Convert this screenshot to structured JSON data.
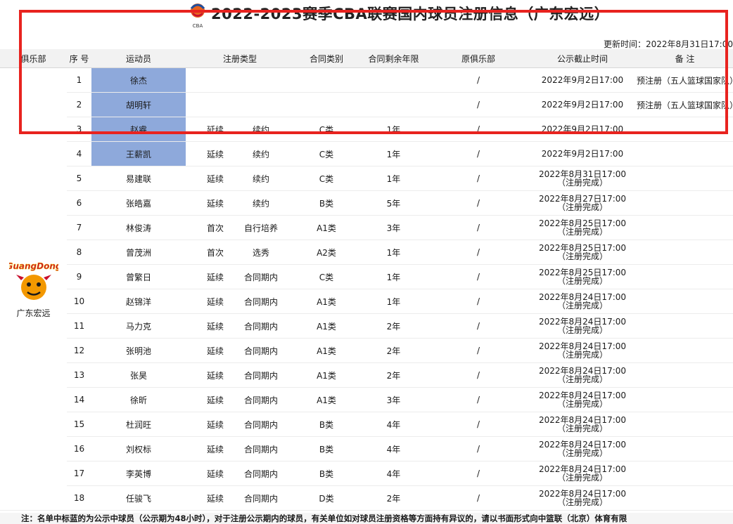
{
  "header": {
    "logo_text": "CBA",
    "title": "2022-2023赛季CBA联赛国内球员注册信息（广东宏远）",
    "updated": "更新时间：2022年8月31日17:00"
  },
  "columns": [
    "俱乐部",
    "序 号",
    "运动员",
    "注册类型",
    "合同类别",
    "合同剩余年限",
    "原俱乐部",
    "公示截止时间",
    "备 注"
  ],
  "club": {
    "name": "广东宏远",
    "logo_text": "GuangDong"
  },
  "rows": [
    {
      "no": "1",
      "name": "徐杰",
      "reg_type": "",
      "reg_sub": "",
      "contract": "",
      "years": "",
      "prev": "/",
      "cutoff1": "2022年9月2日17:00",
      "cutoff2": "",
      "note": "预注册（五人篮球国家队）",
      "hl": true
    },
    {
      "no": "2",
      "name": "胡明轩",
      "reg_type": "",
      "reg_sub": "",
      "contract": "",
      "years": "",
      "prev": "/",
      "cutoff1": "2022年9月2日17:00",
      "cutoff2": "",
      "note": "预注册（五人篮球国家队）",
      "hl": true
    },
    {
      "no": "3",
      "name": "赵睿",
      "reg_type": "延续",
      "reg_sub": "续约",
      "contract": "C类",
      "years": "1年",
      "prev": "/",
      "cutoff1": "2022年9月2日17:00",
      "cutoff2": "",
      "note": "",
      "hl": true
    },
    {
      "no": "4",
      "name": "王薪凯",
      "reg_type": "延续",
      "reg_sub": "续约",
      "contract": "C类",
      "years": "1年",
      "prev": "/",
      "cutoff1": "2022年9月2日17:00",
      "cutoff2": "",
      "note": "",
      "hl": true
    },
    {
      "no": "5",
      "name": "易建联",
      "reg_type": "延续",
      "reg_sub": "续约",
      "contract": "C类",
      "years": "1年",
      "prev": "/",
      "cutoff1": "2022年8月31日17:00",
      "cutoff2": "（注册完成）",
      "note": "",
      "hl": false
    },
    {
      "no": "6",
      "name": "张皓嘉",
      "reg_type": "延续",
      "reg_sub": "续约",
      "contract": "B类",
      "years": "5年",
      "prev": "/",
      "cutoff1": "2022年8月27日17:00",
      "cutoff2": "（注册完成）",
      "note": "",
      "hl": false
    },
    {
      "no": "7",
      "name": "林俊涛",
      "reg_type": "首次",
      "reg_sub": "自行培养",
      "contract": "A1类",
      "years": "3年",
      "prev": "/",
      "cutoff1": "2022年8月25日17:00",
      "cutoff2": "（注册完成）",
      "note": "",
      "hl": false
    },
    {
      "no": "8",
      "name": "曾茂洲",
      "reg_type": "首次",
      "reg_sub": "选秀",
      "contract": "A2类",
      "years": "1年",
      "prev": "/",
      "cutoff1": "2022年8月25日17:00",
      "cutoff2": "（注册完成）",
      "note": "",
      "hl": false
    },
    {
      "no": "9",
      "name": "曾繁日",
      "reg_type": "延续",
      "reg_sub": "合同期内",
      "contract": "C类",
      "years": "1年",
      "prev": "/",
      "cutoff1": "2022年8月25日17:00",
      "cutoff2": "（注册完成）",
      "note": "",
      "hl": false
    },
    {
      "no": "10",
      "name": "赵锦洋",
      "reg_type": "延续",
      "reg_sub": "合同期内",
      "contract": "A1类",
      "years": "1年",
      "prev": "/",
      "cutoff1": "2022年8月24日17:00",
      "cutoff2": "（注册完成）",
      "note": "",
      "hl": false
    },
    {
      "no": "11",
      "name": "马力克",
      "reg_type": "延续",
      "reg_sub": "合同期内",
      "contract": "A1类",
      "years": "2年",
      "prev": "/",
      "cutoff1": "2022年8月24日17:00",
      "cutoff2": "（注册完成）",
      "note": "",
      "hl": false
    },
    {
      "no": "12",
      "name": "张明池",
      "reg_type": "延续",
      "reg_sub": "合同期内",
      "contract": "A1类",
      "years": "2年",
      "prev": "/",
      "cutoff1": "2022年8月24日17:00",
      "cutoff2": "（注册完成）",
      "note": "",
      "hl": false
    },
    {
      "no": "13",
      "name": "张昊",
      "reg_type": "延续",
      "reg_sub": "合同期内",
      "contract": "A1类",
      "years": "2年",
      "prev": "/",
      "cutoff1": "2022年8月24日17:00",
      "cutoff2": "（注册完成）",
      "note": "",
      "hl": false
    },
    {
      "no": "14",
      "name": "徐昕",
      "reg_type": "延续",
      "reg_sub": "合同期内",
      "contract": "A1类",
      "years": "3年",
      "prev": "/",
      "cutoff1": "2022年8月24日17:00",
      "cutoff2": "（注册完成）",
      "note": "",
      "hl": false
    },
    {
      "no": "15",
      "name": "杜润旺",
      "reg_type": "延续",
      "reg_sub": "合同期内",
      "contract": "B类",
      "years": "4年",
      "prev": "/",
      "cutoff1": "2022年8月24日17:00",
      "cutoff2": "（注册完成）",
      "note": "",
      "hl": false
    },
    {
      "no": "16",
      "name": "刘权标",
      "reg_type": "延续",
      "reg_sub": "合同期内",
      "contract": "B类",
      "years": "4年",
      "prev": "/",
      "cutoff1": "2022年8月24日17:00",
      "cutoff2": "（注册完成）",
      "note": "",
      "hl": false
    },
    {
      "no": "17",
      "name": "李英博",
      "reg_type": "延续",
      "reg_sub": "合同期内",
      "contract": "B类",
      "years": "4年",
      "prev": "/",
      "cutoff1": "2022年8月24日17:00",
      "cutoff2": "（注册完成）",
      "note": "",
      "hl": false
    },
    {
      "no": "18",
      "name": "任骏飞",
      "reg_type": "延续",
      "reg_sub": "合同期内",
      "contract": "D类",
      "years": "2年",
      "prev": "/",
      "cutoff1": "2022年8月24日17:00",
      "cutoff2": "（注册完成）",
      "note": "",
      "hl": false
    }
  ],
  "footer": "注：名单中标蓝的为公示中球员（公示期为48小时），对于注册公示期内的球员，有关单位如对球员注册资格等方面持有异议的，请以书面形式向中篮联（北京）体育有限",
  "colors": {
    "highlight": "#8ea9db",
    "annotation_box": "#e8231f",
    "header_bg": "#f2f2f2"
  }
}
